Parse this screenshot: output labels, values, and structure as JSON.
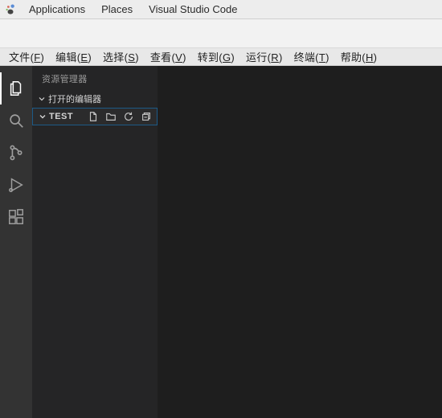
{
  "gnome": {
    "applications": "Applications",
    "places": "Places",
    "app_title": "Visual Studio Code"
  },
  "menu": {
    "file": "文件(",
    "file_u": "F",
    "file_end": ")",
    "edit": "编辑(",
    "edit_u": "E",
    "edit_end": ")",
    "select": "选择(",
    "select_u": "S",
    "select_end": ")",
    "view": "查看(",
    "view_u": "V",
    "view_end": ")",
    "go": "转到(",
    "go_u": "G",
    "go_end": ")",
    "run": "运行(",
    "run_u": "R",
    "run_end": ")",
    "terminal": "终端(",
    "terminal_u": "T",
    "terminal_end": ")",
    "help": "帮助(",
    "help_u": "H",
    "help_end": ")"
  },
  "sidebar": {
    "title": "资源管理器",
    "open_editors": "打开的编辑器",
    "folder_name": "TEST"
  }
}
